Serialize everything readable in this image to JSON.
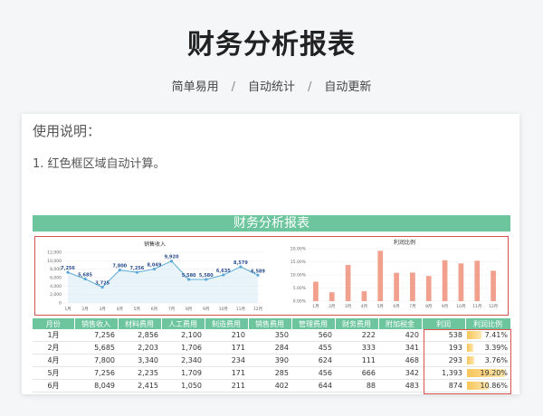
{
  "hero": {
    "title": "财务分析报表"
  },
  "subnav": {
    "items": [
      "简单易用",
      "自动统计",
      "自动更新"
    ],
    "separator": "/"
  },
  "usage": {
    "title": "使用说明：",
    "line1": "1. 红色框区域自动计算。"
  },
  "sheet": {
    "band_title": "财务分析报表"
  },
  "chart_data": [
    {
      "type": "line",
      "title": "销售收入",
      "categories": [
        "1月",
        "2月",
        "3月",
        "4月",
        "5月",
        "6月",
        "7月",
        "8月",
        "9月",
        "10月",
        "11月",
        "12月"
      ],
      "values": [
        7256,
        5685,
        3725,
        7800,
        7256,
        8049,
        9920,
        5580,
        5580,
        6635,
        8579,
        6589
      ],
      "data_labels": [
        "7,256",
        "5,685",
        "3,725",
        "7,800",
        "7,256",
        "8,049",
        "9,920",
        "5,580",
        "5,580",
        "6,635",
        "8,579",
        "6,589"
      ],
      "ylim": [
        0,
        12000
      ],
      "yticks": [
        "12,000",
        "10,000",
        "8,000",
        "6,000",
        "4,000",
        "2,000",
        "0"
      ],
      "color": "#5aa9d6"
    },
    {
      "type": "bar",
      "title": "利润比例",
      "categories": [
        "1月",
        "2月",
        "3月",
        "4月",
        "5月",
        "6月",
        "7月",
        "8月",
        "9月",
        "10月",
        "11月",
        "12月"
      ],
      "values": [
        7.41,
        3.39,
        13.8,
        3.76,
        19.2,
        10.8,
        10.9,
        9.6,
        15.6,
        14.4,
        15.4,
        11.6
      ],
      "ylim": [
        0,
        20
      ],
      "yticks": [
        "20.00%",
        "15.00%",
        "10.00%",
        "5.00%",
        "0.00%"
      ],
      "color": "#f0a08c"
    }
  ],
  "table": {
    "headers": [
      "月份",
      "销售收入",
      "材料费用",
      "人工费用",
      "制造费用",
      "销售费用",
      "管理费用",
      "财务费用",
      "附加税金",
      "利润",
      "利润比例"
    ],
    "rows": [
      {
        "cells": [
          "1月",
          "7,256",
          "2,856",
          "2,100",
          "210",
          "350",
          "560",
          "222",
          "420",
          "538",
          "7.41%"
        ],
        "ratio": 0.0741
      },
      {
        "cells": [
          "2月",
          "5,685",
          "2,203",
          "1,706",
          "171",
          "284",
          "455",
          "333",
          "341",
          "193",
          "3.39%"
        ],
        "ratio": 0.0339
      },
      {
        "cells": [
          "4月",
          "7,800",
          "3,340",
          "2,340",
          "234",
          "390",
          "624",
          "111",
          "468",
          "293",
          "3.76%"
        ],
        "ratio": 0.0376
      },
      {
        "cells": [
          "5月",
          "7,256",
          "2,235",
          "1,709",
          "171",
          "285",
          "456",
          "666",
          "342",
          "1,393",
          "19.20%"
        ],
        "ratio": 0.192
      },
      {
        "cells": [
          "6月",
          "8,049",
          "2,415",
          "1,050",
          "211",
          "402",
          "644",
          "88",
          "483",
          "874",
          "10.86%"
        ],
        "ratio": 0.1086
      }
    ]
  }
}
